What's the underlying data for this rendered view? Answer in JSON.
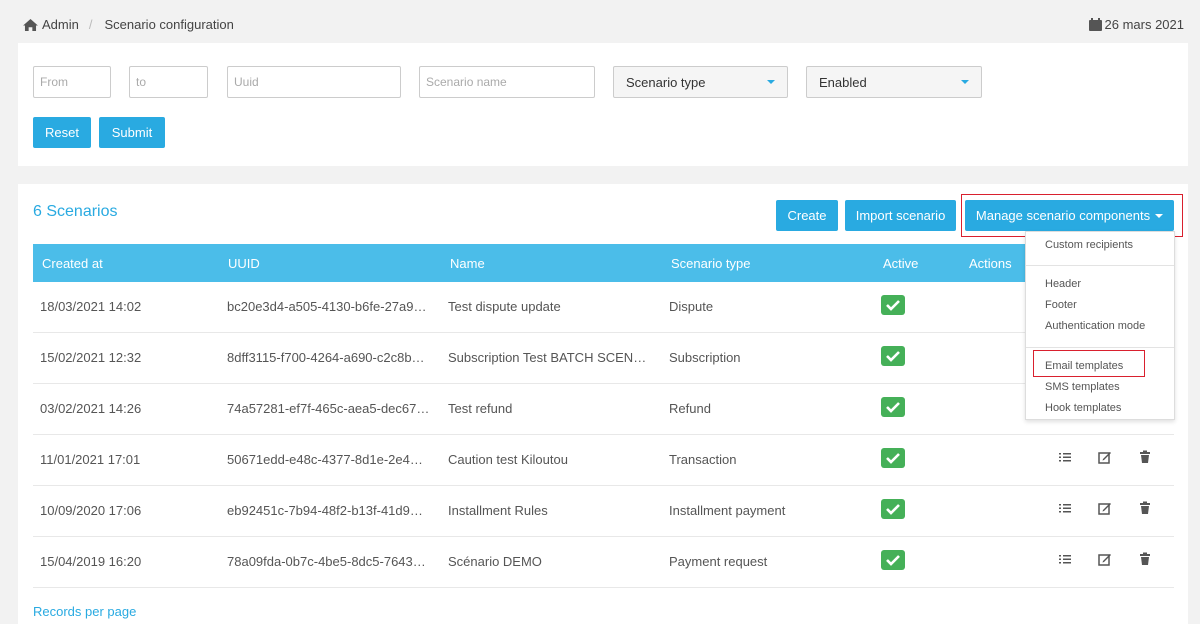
{
  "breadcrumb": {
    "root": "Admin",
    "current": "Scenario configuration"
  },
  "date": "26 mars 2021",
  "filters": {
    "from_placeholder": "From",
    "to_placeholder": "to",
    "uuid_placeholder": "Uuid",
    "name_placeholder": "Scenario name",
    "scenario_type": "Scenario type",
    "enabled": "Enabled",
    "reset_label": "Reset",
    "submit_label": "Submit"
  },
  "list": {
    "count_title": "6 Scenarios",
    "create_label": "Create",
    "import_label": "Import scenario",
    "manage_label": "Manage scenario components",
    "columns": [
      "Created at",
      "UUID",
      "Name",
      "Scenario type",
      "Active",
      "Actions"
    ],
    "rows": [
      {
        "created": "18/03/2021 14:02",
        "uuid": "bc20e3d4-a505-4130-b6fe-27a9…",
        "name": "Test dispute update",
        "type": "Dispute"
      },
      {
        "created": "15/02/2021 12:32",
        "uuid": "8dff3115-f700-4264-a690-c2c8b…",
        "name": "Subscription Test BATCH SCEN…",
        "type": "Subscription"
      },
      {
        "created": "03/02/2021 14:26",
        "uuid": "74a57281-ef7f-465c-aea5-dec67…",
        "name": "Test refund",
        "type": "Refund"
      },
      {
        "created": "11/01/2021 17:01",
        "uuid": "50671edd-e48c-4377-8d1e-2e4…",
        "name": "Caution test Kiloutou",
        "type": "Transaction"
      },
      {
        "created": "10/09/2020 17:06",
        "uuid": "eb92451c-7b94-48f2-b13f-41d9…",
        "name": "Installment Rules",
        "type": "Installment payment"
      },
      {
        "created": "15/04/2019 16:20",
        "uuid": "78a09fda-0b7c-4be5-8dc5-7643…",
        "name": "Scénario DEMO",
        "type": "Payment request"
      }
    ],
    "records_per_page": "Records per page"
  },
  "dropdown": {
    "items": [
      "Custom recipients",
      "Header",
      "Footer",
      "Authentication mode",
      "Email templates",
      "SMS templates",
      "Hook templates"
    ]
  },
  "colors": {
    "accent": "#29aae1",
    "header": "#4bbde9",
    "active": "#45b058",
    "highlight": "#d9202e"
  }
}
